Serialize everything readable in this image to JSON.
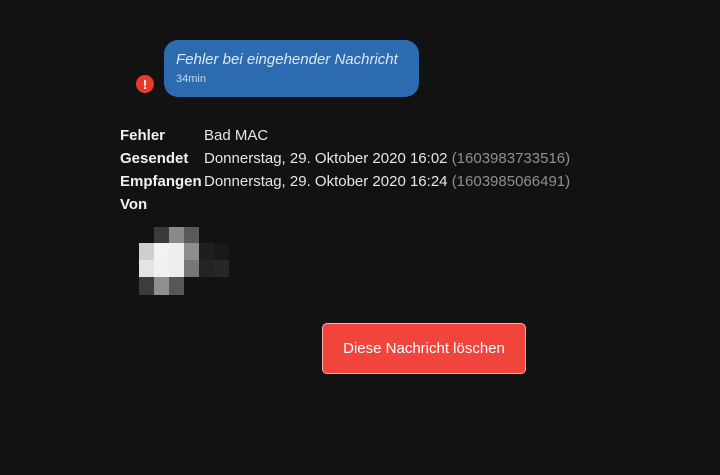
{
  "message": {
    "text": "Fehler bei eingehender Nachricht",
    "time": "34min",
    "status_icon": "exclamation-icon",
    "status_color": "#e8392f"
  },
  "details": {
    "error": {
      "label": "Fehler",
      "value": "Bad MAC"
    },
    "sent": {
      "label": "Gesendet",
      "value": "Donnerstag, 29. Oktober 2020 16:02",
      "timestamp": "(1603983733516)"
    },
    "received": {
      "label": "Empfangen",
      "value": "Donnerstag, 29. Oktober 2020 16:24",
      "timestamp": "(1603985066491)"
    },
    "from": {
      "label": "Von"
    }
  },
  "actions": {
    "delete_label": "Diese Nachricht löschen",
    "delete_color": "#f0443c"
  },
  "colors": {
    "background": "#121212",
    "bubble": "#2c6bb0"
  }
}
